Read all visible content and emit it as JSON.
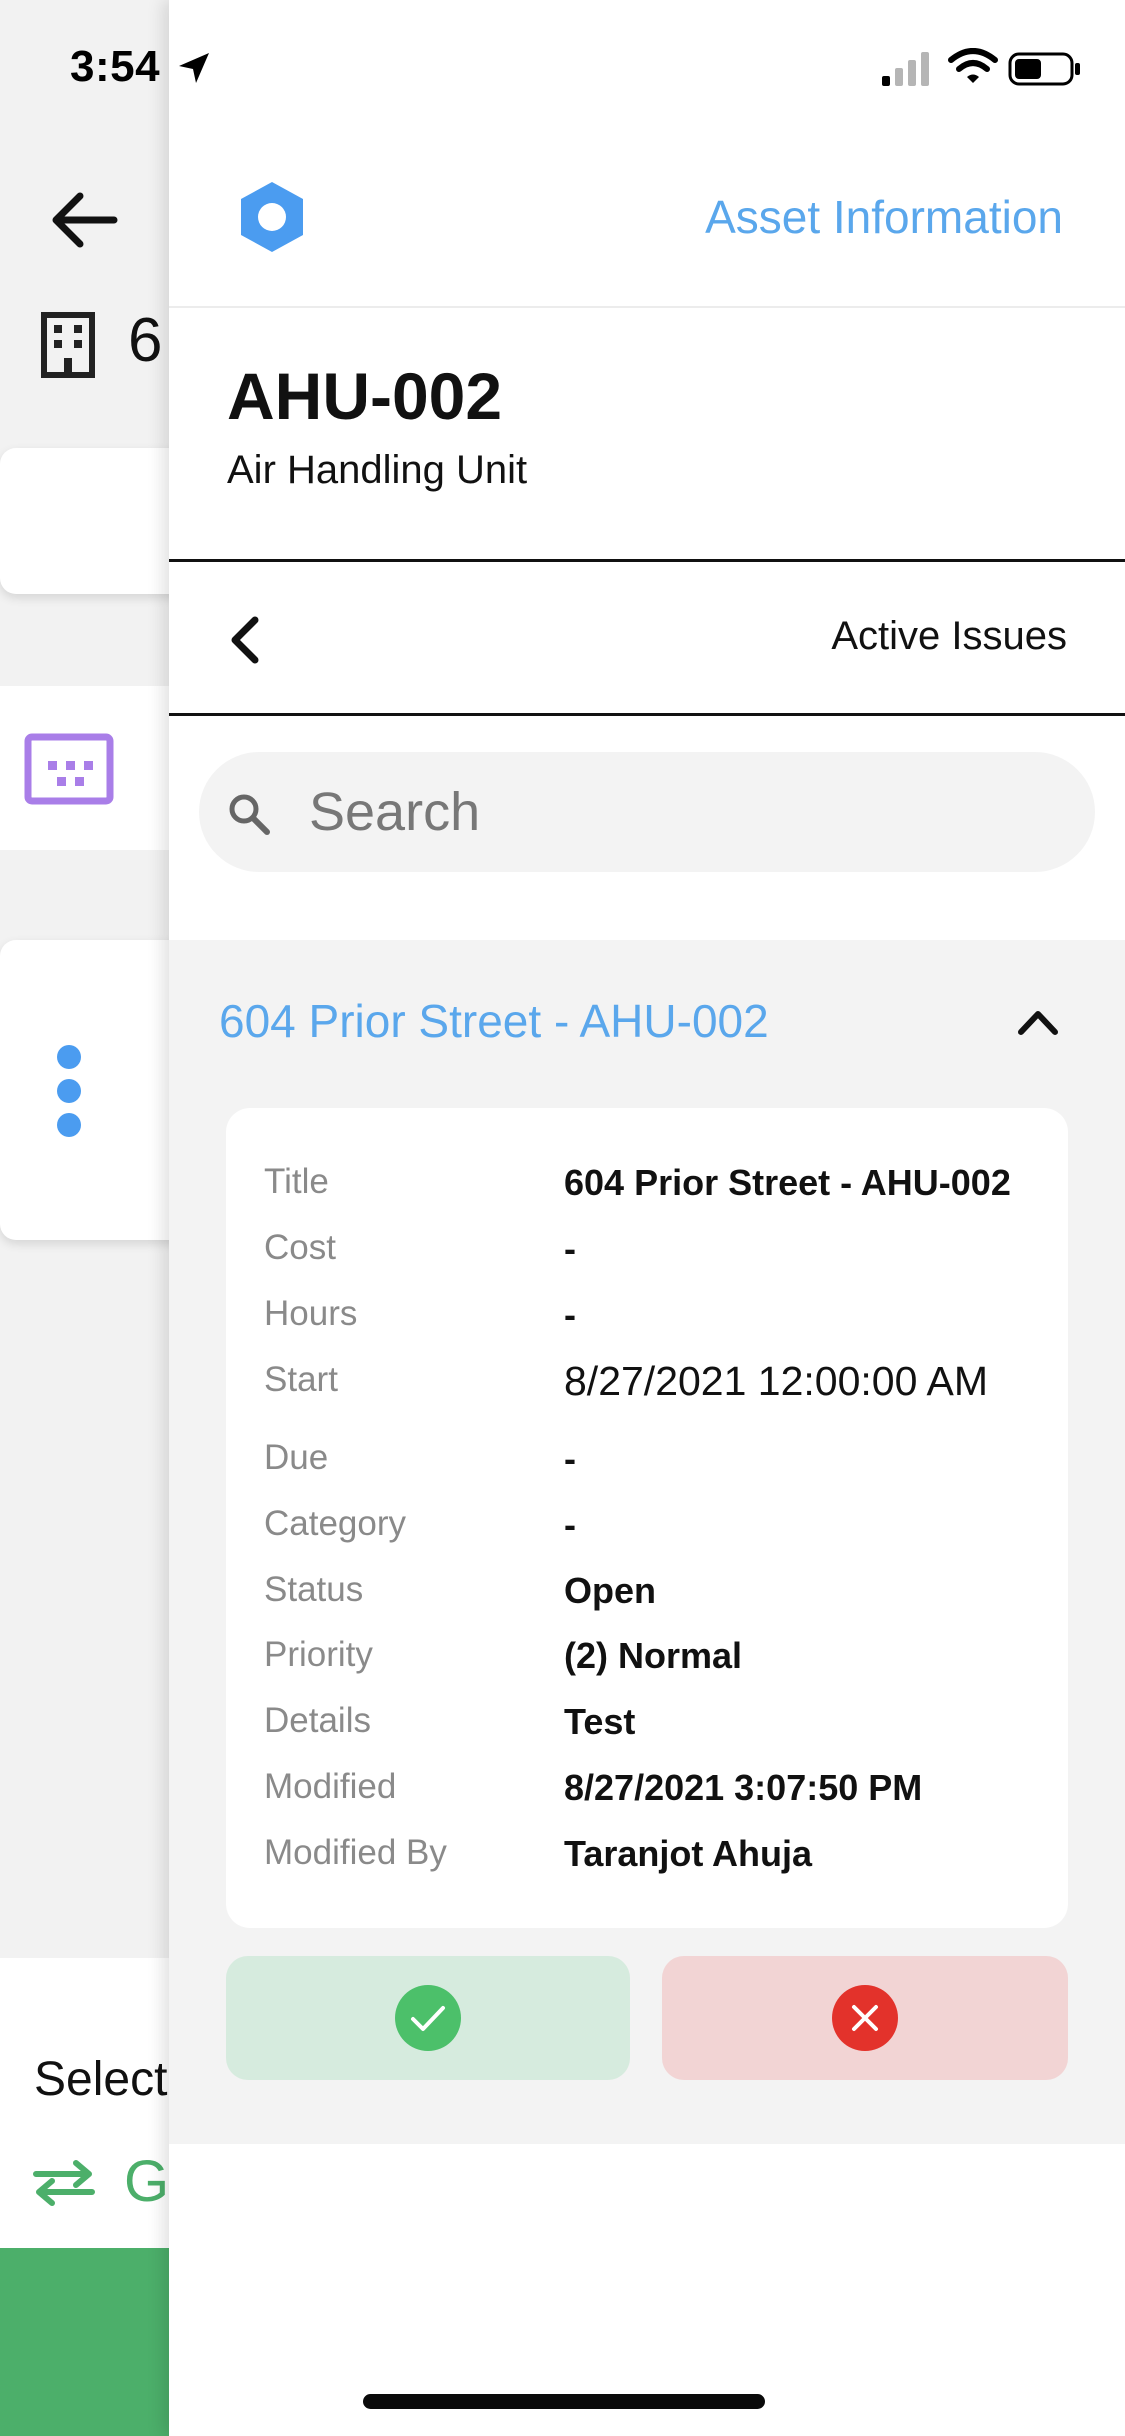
{
  "status_bar": {
    "time": "3:54"
  },
  "background": {
    "header_number": "6",
    "select_label": "Select",
    "green_letter": "G",
    "accent_purple": "#a97ee8",
    "accent_green": "#4caf6a",
    "accent_blue": "#4b9cf0"
  },
  "drawer": {
    "header_link": "Asset Information",
    "asset": {
      "id": "AHU-002",
      "type": "Air Handling Unit"
    },
    "nav_title": "Active Issues",
    "search": {
      "placeholder": "Search",
      "value": ""
    },
    "issue": {
      "heading": "604 Prior Street - AHU-002",
      "fields": [
        {
          "label": "Title",
          "value": "604 Prior Street - AHU-002"
        },
        {
          "label": "Cost",
          "value": "-"
        },
        {
          "label": "Hours",
          "value": "-"
        },
        {
          "label": "Start",
          "value": "8/27/2021 12:00:00 AM"
        },
        {
          "label": "Due",
          "value": "-"
        },
        {
          "label": "Category",
          "value": "-"
        },
        {
          "label": "Status",
          "value": "Open"
        },
        {
          "label": "Priority",
          "value": "(2) Normal"
        },
        {
          "label": "Details",
          "value": "Test"
        },
        {
          "label": "Modified",
          "value": "8/27/2021 3:07:50 PM"
        },
        {
          "label": "Modified By",
          "value": "Taranjot Ahuja"
        }
      ]
    },
    "accent_link": "#5aa7ec",
    "accept_color": "#4cc06a",
    "reject_color": "#e3322b"
  }
}
